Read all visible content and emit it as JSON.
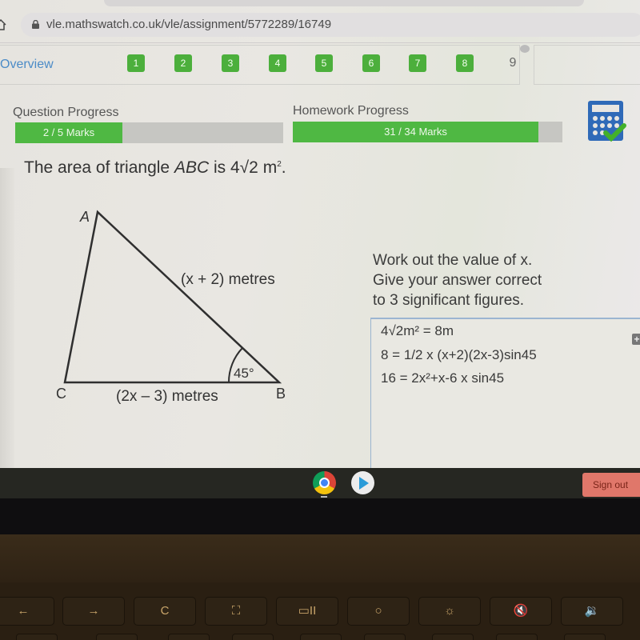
{
  "browser": {
    "url": "vle.mathswatch.co.uk/vle/assignment/5772289/16749"
  },
  "nav": {
    "overview_label": "Overview",
    "questions": [
      {
        "label": "1",
        "completed": true
      },
      {
        "label": "2",
        "completed": true
      },
      {
        "label": "3",
        "completed": true
      },
      {
        "label": "4",
        "completed": true
      },
      {
        "label": "5",
        "completed": true
      },
      {
        "label": "6",
        "completed": true
      },
      {
        "label": "7",
        "completed": true
      },
      {
        "label": "8",
        "completed": true
      },
      {
        "label": "9",
        "completed": false,
        "current": true
      }
    ]
  },
  "progress": {
    "question": {
      "label": "Question Progress",
      "text": "2 / 5 Marks",
      "value": 2,
      "max": 5
    },
    "homework": {
      "label": "Homework Progress",
      "text": "31 / 34 Marks",
      "value": 31,
      "max": 34
    }
  },
  "question": {
    "prefix": "The area of triangle ",
    "triangle_name": "ABC",
    "middle": " is 4√2 m",
    "superscript": "2",
    "suffix": ".",
    "diagram": {
      "vertices": {
        "A": "A",
        "B": "B",
        "C": "C"
      },
      "side_AB": "(x + 2) metres",
      "side_CB": "(2x – 3) metres",
      "angle_B": "45°"
    },
    "instructions": [
      "Work out the value of x.",
      "Give your answer correct",
      "to 3 significant figures."
    ]
  },
  "answer": {
    "lines": [
      "4√2m² = 8m",
      "8 = 1/2 x (x+2)(2x-3)sin45",
      "16 = 2x²+x-6 x sin45"
    ]
  },
  "shelf": {
    "apps": [
      "chrome-icon",
      "play-store-icon"
    ],
    "signout_label": "Sign out"
  },
  "keyboard": {
    "keys": [
      "←",
      "→",
      "C",
      "⛶",
      "▭II",
      "○",
      "☼",
      "🔇",
      "🔉"
    ]
  },
  "colors": {
    "accent_green": "#4caf3c",
    "link_blue": "#4b8bc7",
    "signout_red": "#e0776a"
  }
}
